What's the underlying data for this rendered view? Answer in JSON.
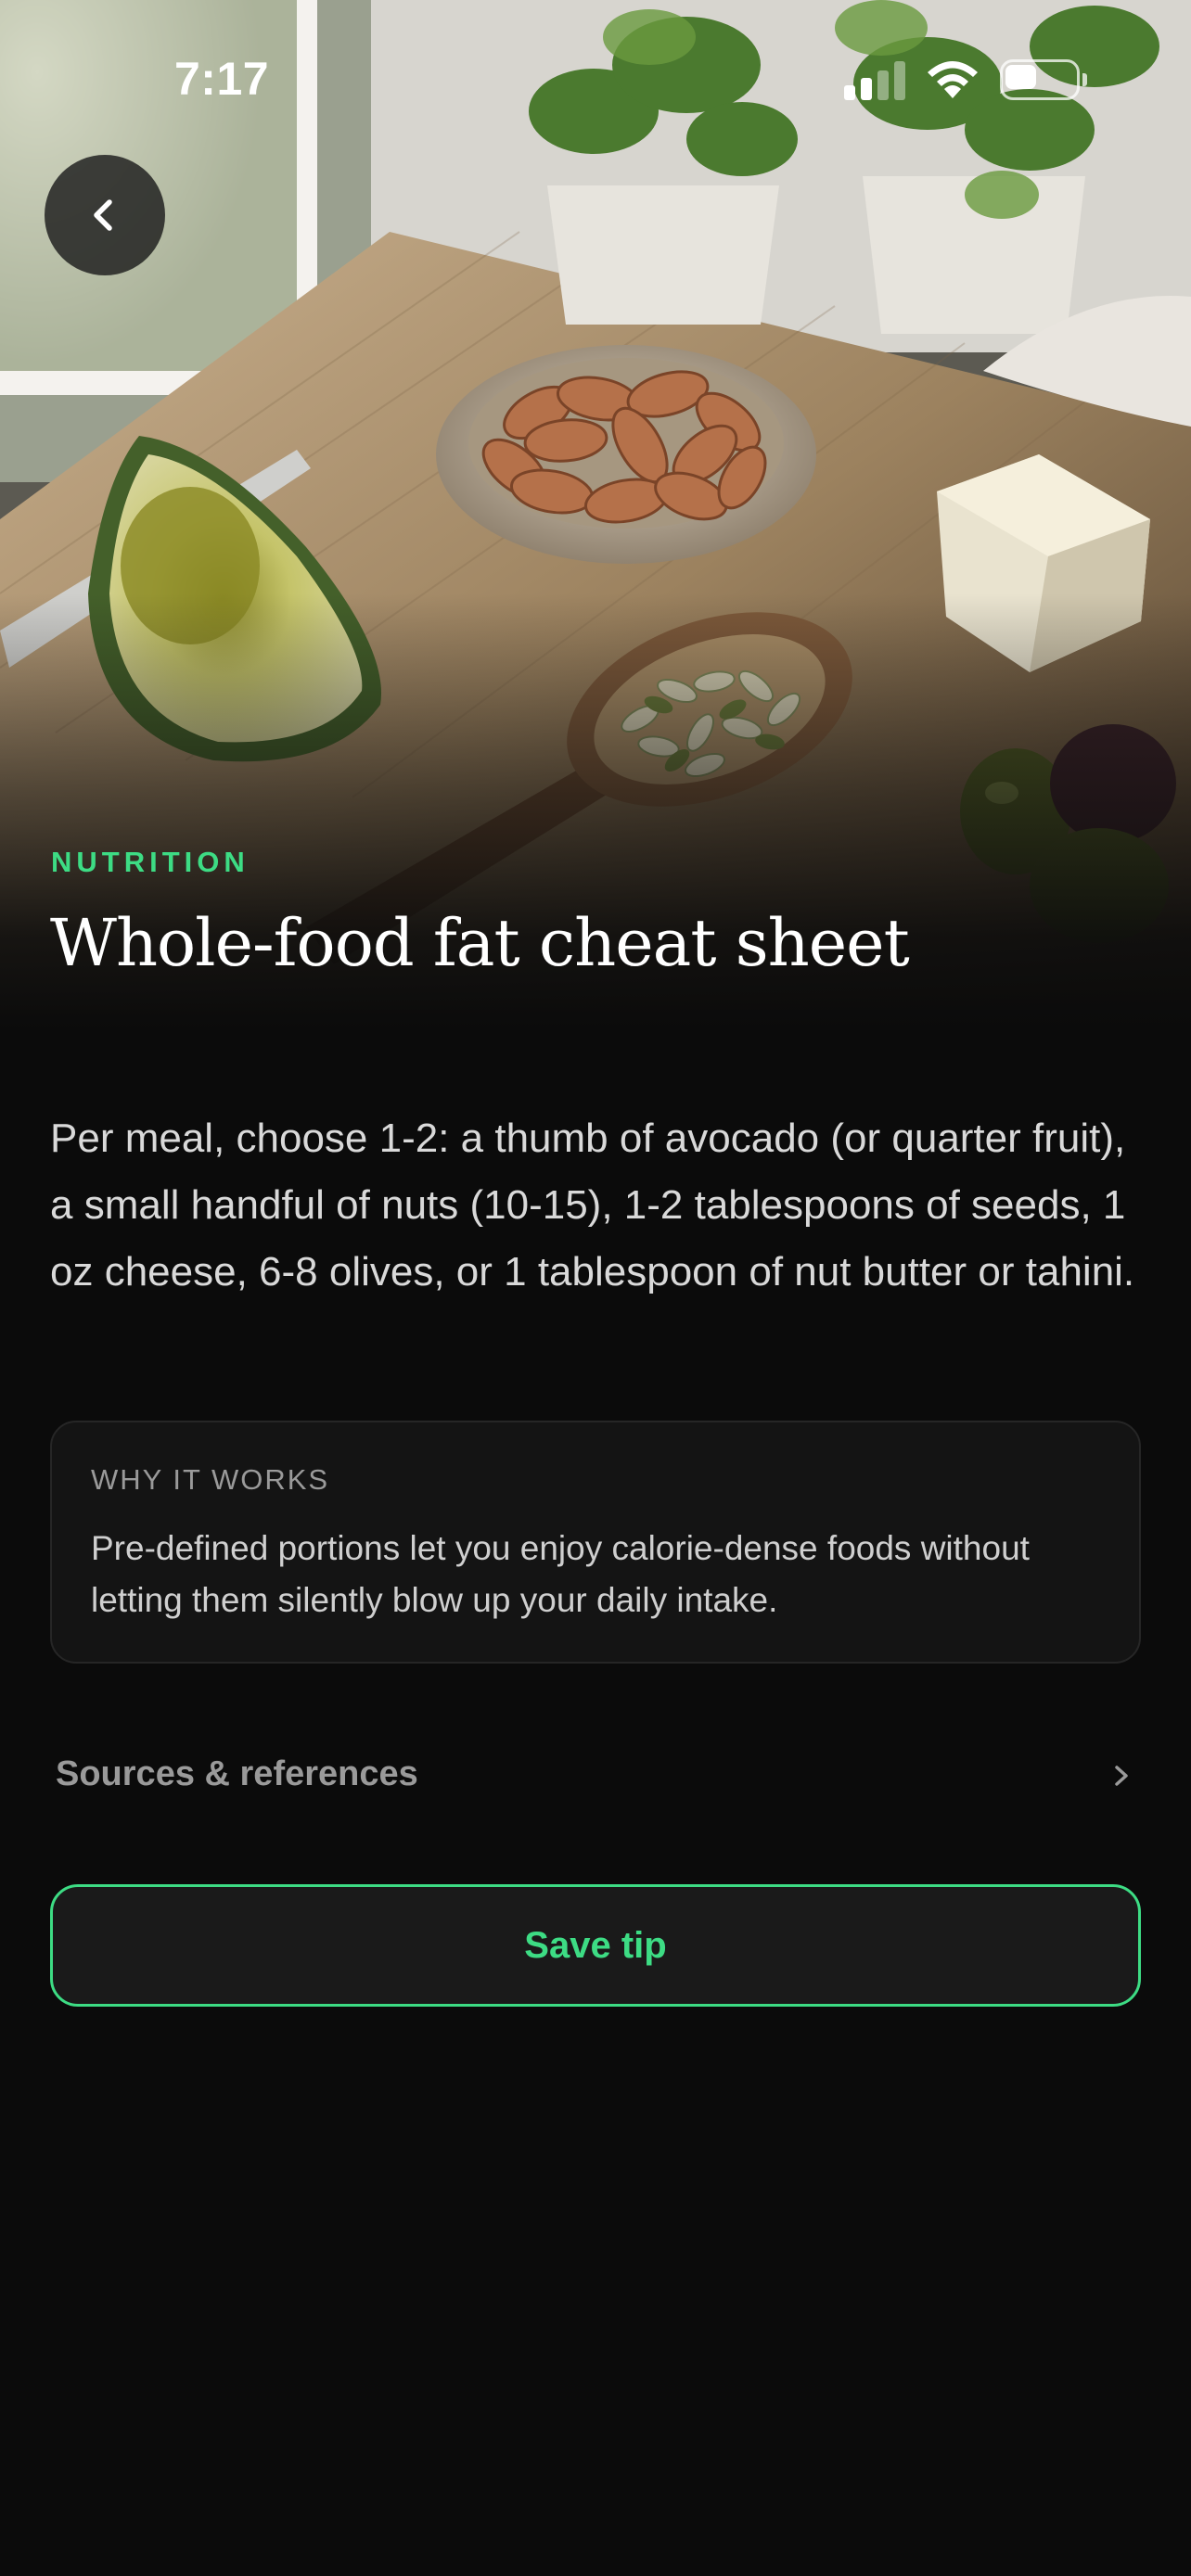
{
  "status_bar": {
    "time": "7:17",
    "signal_bars": 4,
    "signal_bars_active": 2,
    "battery_level": 0.45
  },
  "hero": {
    "image": "photo of avocado, almonds, seeds in wooden spoon, cheese cube and olives on a wooden table with basil plants"
  },
  "article": {
    "category": "NUTRITION",
    "title": "Whole-food fat cheat sheet",
    "body": "Per meal, choose 1-2: a thumb of avocado (or quarter fruit), a small handful of nuts (10-15), 1-2 tablespoons of seeds, 1 oz cheese, 6-8 olives, or 1 tablespoon of nut butter or tahini."
  },
  "why_card": {
    "label": "WHY IT WORKS",
    "text": "Pre-defined portions let you enjoy calorie-dense foods without letting them silently blow up your daily intake."
  },
  "sources": {
    "label": "Sources & references"
  },
  "actions": {
    "save_label": "Save tip"
  },
  "icons": {
    "back": "chevron-left-icon",
    "sources": "chevron-right-icon"
  },
  "colors": {
    "accent": "#3ddc84",
    "background": "#0b0b0b",
    "card": "#141414"
  }
}
